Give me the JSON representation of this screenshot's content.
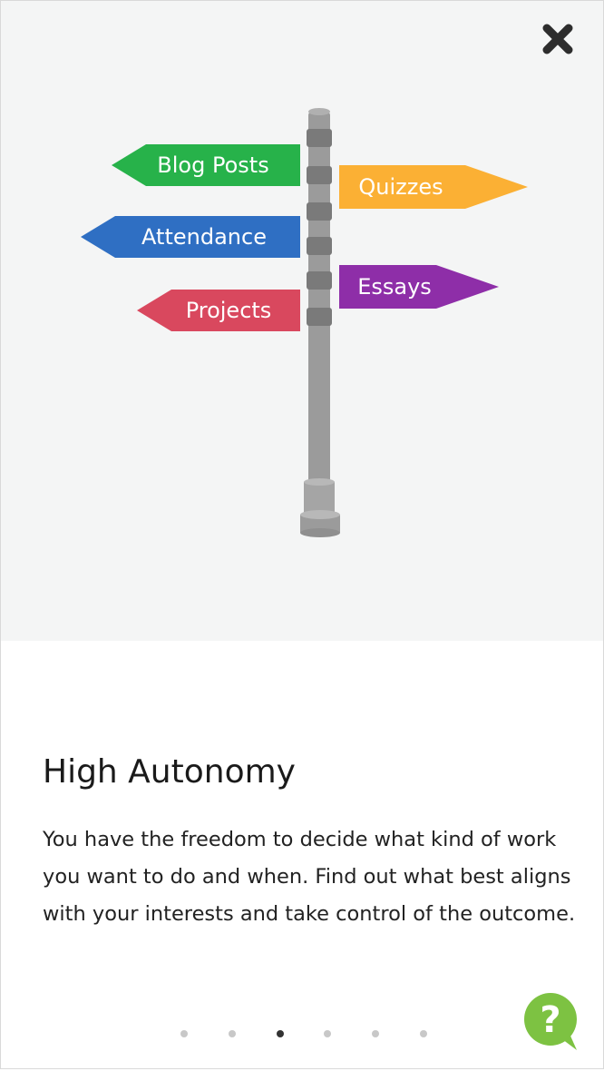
{
  "hero": {
    "signs": [
      {
        "label": "Blog Posts",
        "color": "#27b24a"
      },
      {
        "label": "Quizzes",
        "color": "#fbb034"
      },
      {
        "label": "Attendance",
        "color": "#2f6fc3"
      },
      {
        "label": "Essays",
        "color": "#8e2ea8"
      },
      {
        "label": "Projects",
        "color": "#d9485e"
      }
    ],
    "pole_color": "#9b9b9b",
    "close_icon": "close-icon"
  },
  "slide": {
    "title": "High Autonomy",
    "description": "You have the freedom to decide what kind of work you want to do and when. Find out what best aligns with your interests and take control of the outcome."
  },
  "pager": {
    "total": 6,
    "active_index": 2
  },
  "help": {
    "icon": "help-question-icon",
    "glyph": "?",
    "color": "#7dc242"
  }
}
